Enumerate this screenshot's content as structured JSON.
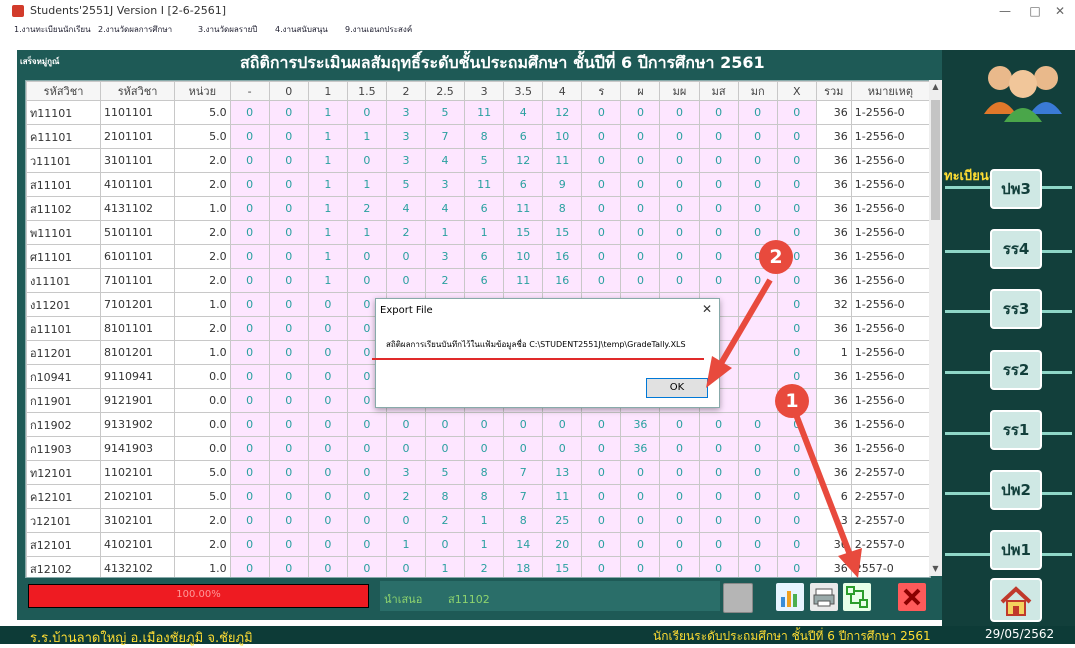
{
  "window": {
    "title": "Students'2551J Version I [2-6-2561]",
    "min": "—",
    "max": "□",
    "close": "✕"
  },
  "menu": [
    "1.งานทะเบียนนักเรียน",
    "2.งานวัดผลการศึกษา",
    "3.งานวัดผลรายปี",
    "4.งานสนับสนุน",
    "9.งานเอนกประสงค์"
  ],
  "header": {
    "small_title": "เสร็จหมู่กูณ์",
    "main_title": "สถิติการประเมินผลสัมฤทธิ์ระดับชั้นประถมศึกษา  ชั้นปีที่ 6  ปีการศึกษา 2561"
  },
  "table": {
    "columns": [
      "รหัสวิชา",
      "รหัสวิชา",
      "หน่วย",
      "-",
      "0",
      "1",
      "1.5",
      "2",
      "2.5",
      "3",
      "3.5",
      "4",
      "ร",
      "ผ",
      "มผ",
      "มส",
      "มก",
      "X",
      "รวม",
      "หมายเหตุ"
    ],
    "rows": [
      [
        "ท11101",
        "1101101",
        "5.0",
        "0",
        "0",
        "1",
        "0",
        "3",
        "5",
        "11",
        "4",
        "12",
        "0",
        "0",
        "0",
        "0",
        "0",
        "0",
        "36",
        "1-2556-0"
      ],
      [
        "ค11101",
        "2101101",
        "5.0",
        "0",
        "0",
        "1",
        "1",
        "3",
        "7",
        "8",
        "6",
        "10",
        "0",
        "0",
        "0",
        "0",
        "0",
        "0",
        "36",
        "1-2556-0"
      ],
      [
        "ว11101",
        "3101101",
        "2.0",
        "0",
        "0",
        "1",
        "0",
        "3",
        "4",
        "5",
        "12",
        "11",
        "0",
        "0",
        "0",
        "0",
        "0",
        "0",
        "36",
        "1-2556-0"
      ],
      [
        "ส11101",
        "4101101",
        "2.0",
        "0",
        "0",
        "1",
        "1",
        "5",
        "3",
        "11",
        "6",
        "9",
        "0",
        "0",
        "0",
        "0",
        "0",
        "0",
        "36",
        "1-2556-0"
      ],
      [
        "ส11102",
        "4131102",
        "1.0",
        "0",
        "0",
        "1",
        "2",
        "4",
        "4",
        "6",
        "11",
        "8",
        "0",
        "0",
        "0",
        "0",
        "0",
        "0",
        "36",
        "1-2556-0"
      ],
      [
        "พ11101",
        "5101101",
        "2.0",
        "0",
        "0",
        "1",
        "1",
        "2",
        "1",
        "1",
        "15",
        "15",
        "0",
        "0",
        "0",
        "0",
        "0",
        "0",
        "36",
        "1-2556-0"
      ],
      [
        "ศ11101",
        "6101101",
        "2.0",
        "0",
        "0",
        "1",
        "0",
        "0",
        "3",
        "6",
        "10",
        "16",
        "0",
        "0",
        "0",
        "0",
        "0",
        "0",
        "36",
        "1-2556-0"
      ],
      [
        "ง11101",
        "7101101",
        "2.0",
        "0",
        "0",
        "1",
        "0",
        "0",
        "2",
        "6",
        "11",
        "16",
        "0",
        "0",
        "0",
        "0",
        "0",
        "0",
        "36",
        "1-2556-0"
      ],
      [
        "ง11201",
        "7101201",
        "1.0",
        "0",
        "0",
        "0",
        "0",
        "",
        "",
        "",
        "",
        "",
        "",
        "",
        "",
        "",
        "",
        "0",
        "32",
        "1-2556-0"
      ],
      [
        "อ11101",
        "8101101",
        "2.0",
        "0",
        "0",
        "0",
        "0",
        "",
        "",
        "",
        "",
        "",
        "",
        "",
        "",
        "",
        "",
        "0",
        "36",
        "1-2556-0"
      ],
      [
        "อ11201",
        "8101201",
        "1.0",
        "0",
        "0",
        "0",
        "0",
        "",
        "",
        "",
        "",
        "",
        "",
        "",
        "",
        "",
        "",
        "0",
        "1",
        "1-2556-0"
      ],
      [
        "ก10941",
        "9110941",
        "0.0",
        "0",
        "0",
        "0",
        "0",
        "",
        "",
        "",
        "",
        "",
        "",
        "",
        "",
        "",
        "",
        "0",
        "36",
        "1-2556-0"
      ],
      [
        "ก11901",
        "9121901",
        "0.0",
        "0",
        "0",
        "0",
        "0",
        "",
        "",
        "",
        "",
        "",
        "",
        "",
        "",
        "",
        "",
        "0",
        "36",
        "1-2556-0"
      ],
      [
        "ก11902",
        "9131902",
        "0.0",
        "0",
        "0",
        "0",
        "0",
        "0",
        "0",
        "0",
        "0",
        "0",
        "0",
        "36",
        "0",
        "0",
        "0",
        "0",
        "36",
        "1-2556-0"
      ],
      [
        "ก11903",
        "9141903",
        "0.0",
        "0",
        "0",
        "0",
        "0",
        "0",
        "0",
        "0",
        "0",
        "0",
        "0",
        "36",
        "0",
        "0",
        "0",
        "0",
        "36",
        "1-2556-0"
      ],
      [
        "ท12101",
        "1102101",
        "5.0",
        "0",
        "0",
        "0",
        "0",
        "3",
        "5",
        "8",
        "7",
        "13",
        "0",
        "0",
        "0",
        "0",
        "0",
        "0",
        "36",
        "2-2557-0"
      ],
      [
        "ค12101",
        "2102101",
        "5.0",
        "0",
        "0",
        "0",
        "0",
        "2",
        "8",
        "8",
        "7",
        "11",
        "0",
        "0",
        "0",
        "0",
        "0",
        "0",
        "6",
        "2-2557-0"
      ],
      [
        "ว12101",
        "3102101",
        "2.0",
        "0",
        "0",
        "0",
        "0",
        "0",
        "2",
        "1",
        "8",
        "25",
        "0",
        "0",
        "0",
        "0",
        "0",
        "0",
        "3",
        "2-2557-0"
      ],
      [
        "ส12101",
        "4102101",
        "2.0",
        "0",
        "0",
        "0",
        "0",
        "1",
        "0",
        "1",
        "14",
        "20",
        "0",
        "0",
        "0",
        "0",
        "0",
        "0",
        "36",
        "2-2557-0"
      ],
      [
        "ส12102",
        "4132102",
        "1.0",
        "0",
        "0",
        "0",
        "0",
        "0",
        "1",
        "2",
        "18",
        "15",
        "0",
        "0",
        "0",
        "0",
        "0",
        "0",
        "36",
        "2557-0"
      ]
    ]
  },
  "status": {
    "progress_text": "100.00%",
    "progress_fraction": 1.0,
    "presenter_label": "นำเสนอ",
    "presenter_value": "ส11102"
  },
  "toolbar": {
    "chart": "chart-icon",
    "print": "printer-icon",
    "export": "export-icon",
    "close": "close-icon"
  },
  "dialog": {
    "title": "Export File",
    "message": "สถิติผลการเรียนบันทึกไว้ในแฟ้มข้อมูลชื่อ C:\\STUDENT2551J\\temp\\GradeTally.XLS",
    "ok": "OK",
    "close": "✕"
  },
  "markers": {
    "one": "1",
    "two": "2"
  },
  "sidebar": {
    "header": "ทะเบียน&วัดผล",
    "buttons": [
      "ปพ3",
      "รร4",
      "รร3",
      "รร2",
      "รร1",
      "ปพ2",
      "ปพ1"
    ]
  },
  "footer": {
    "school": "ร.ร.บ้านลาดใหญ่  อ.เมืองชัยภูมิ  จ.ชัยภูมิ",
    "info": "นักเรียนระดับประถมศึกษา  ชั้นปีที่ 6  ปีการศึกษา 2561",
    "date": "29/05/2562"
  },
  "colors": {
    "dark_teal": "#1e5a56",
    "pink_cell": "#fde6ff",
    "accent_red": "#e84a3d",
    "footer_yellow": "#ffdd33"
  }
}
